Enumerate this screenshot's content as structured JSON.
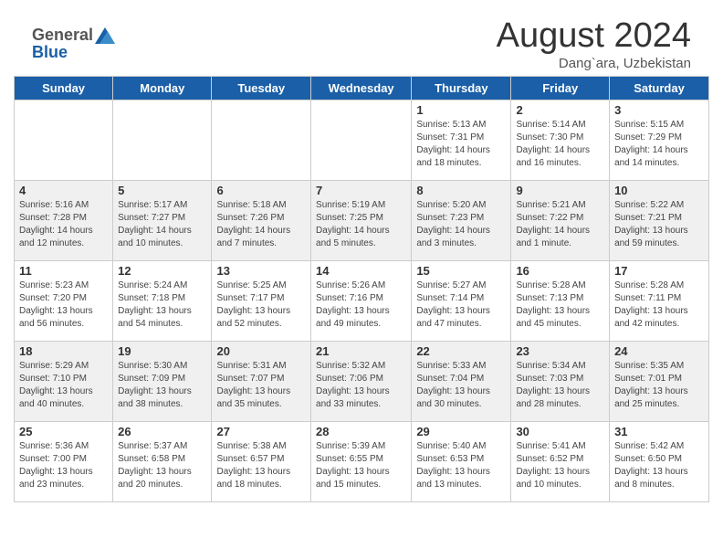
{
  "header": {
    "logo_general": "General",
    "logo_blue": "Blue",
    "month_year": "August 2024",
    "location": "Dang`ara, Uzbekistan"
  },
  "weekdays": [
    "Sunday",
    "Monday",
    "Tuesday",
    "Wednesday",
    "Thursday",
    "Friday",
    "Saturday"
  ],
  "weeks": [
    {
      "days": [
        {
          "num": "",
          "info": ""
        },
        {
          "num": "",
          "info": ""
        },
        {
          "num": "",
          "info": ""
        },
        {
          "num": "",
          "info": ""
        },
        {
          "num": "1",
          "info": "Sunrise: 5:13 AM\nSunset: 7:31 PM\nDaylight: 14 hours and 18 minutes."
        },
        {
          "num": "2",
          "info": "Sunrise: 5:14 AM\nSunset: 7:30 PM\nDaylight: 14 hours and 16 minutes."
        },
        {
          "num": "3",
          "info": "Sunrise: 5:15 AM\nSunset: 7:29 PM\nDaylight: 14 hours and 14 minutes."
        }
      ]
    },
    {
      "days": [
        {
          "num": "4",
          "info": "Sunrise: 5:16 AM\nSunset: 7:28 PM\nDaylight: 14 hours and 12 minutes."
        },
        {
          "num": "5",
          "info": "Sunrise: 5:17 AM\nSunset: 7:27 PM\nDaylight: 14 hours and 10 minutes."
        },
        {
          "num": "6",
          "info": "Sunrise: 5:18 AM\nSunset: 7:26 PM\nDaylight: 14 hours and 7 minutes."
        },
        {
          "num": "7",
          "info": "Sunrise: 5:19 AM\nSunset: 7:25 PM\nDaylight: 14 hours and 5 minutes."
        },
        {
          "num": "8",
          "info": "Sunrise: 5:20 AM\nSunset: 7:23 PM\nDaylight: 14 hours and 3 minutes."
        },
        {
          "num": "9",
          "info": "Sunrise: 5:21 AM\nSunset: 7:22 PM\nDaylight: 14 hours and 1 minute."
        },
        {
          "num": "10",
          "info": "Sunrise: 5:22 AM\nSunset: 7:21 PM\nDaylight: 13 hours and 59 minutes."
        }
      ]
    },
    {
      "days": [
        {
          "num": "11",
          "info": "Sunrise: 5:23 AM\nSunset: 7:20 PM\nDaylight: 13 hours and 56 minutes."
        },
        {
          "num": "12",
          "info": "Sunrise: 5:24 AM\nSunset: 7:18 PM\nDaylight: 13 hours and 54 minutes."
        },
        {
          "num": "13",
          "info": "Sunrise: 5:25 AM\nSunset: 7:17 PM\nDaylight: 13 hours and 52 minutes."
        },
        {
          "num": "14",
          "info": "Sunrise: 5:26 AM\nSunset: 7:16 PM\nDaylight: 13 hours and 49 minutes."
        },
        {
          "num": "15",
          "info": "Sunrise: 5:27 AM\nSunset: 7:14 PM\nDaylight: 13 hours and 47 minutes."
        },
        {
          "num": "16",
          "info": "Sunrise: 5:28 AM\nSunset: 7:13 PM\nDaylight: 13 hours and 45 minutes."
        },
        {
          "num": "17",
          "info": "Sunrise: 5:28 AM\nSunset: 7:11 PM\nDaylight: 13 hours and 42 minutes."
        }
      ]
    },
    {
      "days": [
        {
          "num": "18",
          "info": "Sunrise: 5:29 AM\nSunset: 7:10 PM\nDaylight: 13 hours and 40 minutes."
        },
        {
          "num": "19",
          "info": "Sunrise: 5:30 AM\nSunset: 7:09 PM\nDaylight: 13 hours and 38 minutes."
        },
        {
          "num": "20",
          "info": "Sunrise: 5:31 AM\nSunset: 7:07 PM\nDaylight: 13 hours and 35 minutes."
        },
        {
          "num": "21",
          "info": "Sunrise: 5:32 AM\nSunset: 7:06 PM\nDaylight: 13 hours and 33 minutes."
        },
        {
          "num": "22",
          "info": "Sunrise: 5:33 AM\nSunset: 7:04 PM\nDaylight: 13 hours and 30 minutes."
        },
        {
          "num": "23",
          "info": "Sunrise: 5:34 AM\nSunset: 7:03 PM\nDaylight: 13 hours and 28 minutes."
        },
        {
          "num": "24",
          "info": "Sunrise: 5:35 AM\nSunset: 7:01 PM\nDaylight: 13 hours and 25 minutes."
        }
      ]
    },
    {
      "days": [
        {
          "num": "25",
          "info": "Sunrise: 5:36 AM\nSunset: 7:00 PM\nDaylight: 13 hours and 23 minutes."
        },
        {
          "num": "26",
          "info": "Sunrise: 5:37 AM\nSunset: 6:58 PM\nDaylight: 13 hours and 20 minutes."
        },
        {
          "num": "27",
          "info": "Sunrise: 5:38 AM\nSunset: 6:57 PM\nDaylight: 13 hours and 18 minutes."
        },
        {
          "num": "28",
          "info": "Sunrise: 5:39 AM\nSunset: 6:55 PM\nDaylight: 13 hours and 15 minutes."
        },
        {
          "num": "29",
          "info": "Sunrise: 5:40 AM\nSunset: 6:53 PM\nDaylight: 13 hours and 13 minutes."
        },
        {
          "num": "30",
          "info": "Sunrise: 5:41 AM\nSunset: 6:52 PM\nDaylight: 13 hours and 10 minutes."
        },
        {
          "num": "31",
          "info": "Sunrise: 5:42 AM\nSunset: 6:50 PM\nDaylight: 13 hours and 8 minutes."
        }
      ]
    }
  ]
}
